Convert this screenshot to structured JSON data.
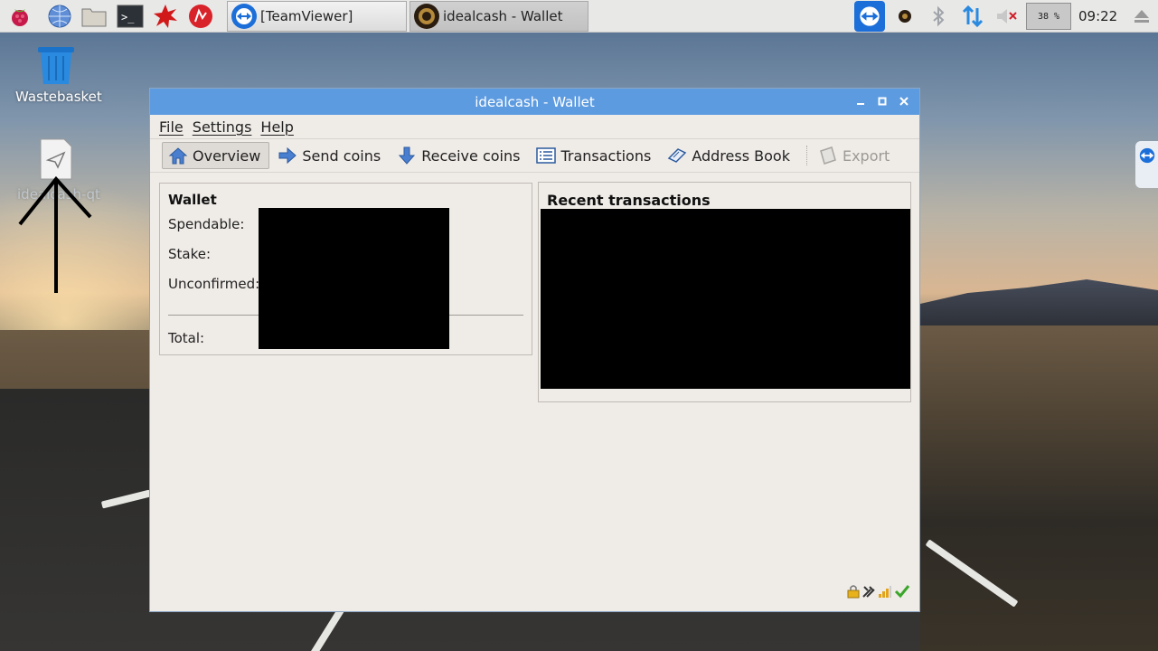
{
  "taskbar": {
    "tasks": [
      {
        "label": "[TeamViewer]"
      },
      {
        "label": "idealcash - Wallet"
      }
    ],
    "cpu_label": "38 %",
    "clock": "09:22"
  },
  "desktop": {
    "icons": [
      {
        "label": "Wastebasket"
      },
      {
        "label": "idealcash-qt"
      }
    ]
  },
  "window": {
    "title": "idealcash - Wallet",
    "menu": [
      "File",
      "Settings",
      "Help"
    ],
    "toolbar": [
      {
        "label": "Overview",
        "icon": "home-icon"
      },
      {
        "label": "Send coins",
        "icon": "send-arrow-icon"
      },
      {
        "label": "Receive coins",
        "icon": "receive-arrow-icon"
      },
      {
        "label": "Transactions",
        "icon": "list-icon"
      },
      {
        "label": "Address Book",
        "icon": "address-book-icon"
      },
      {
        "label": "Export",
        "icon": "export-icon"
      }
    ],
    "wallet_panel": {
      "title": "Wallet",
      "rows": [
        "Spendable:",
        "Stake:",
        "Unconfirmed:",
        "Total:"
      ]
    },
    "recent_panel": {
      "title": "Recent transactions"
    }
  },
  "colors": {
    "titlebar": "#5d9be0",
    "window_bg": "#efebe7",
    "teamviewer_blue": "#1c6fd9"
  }
}
